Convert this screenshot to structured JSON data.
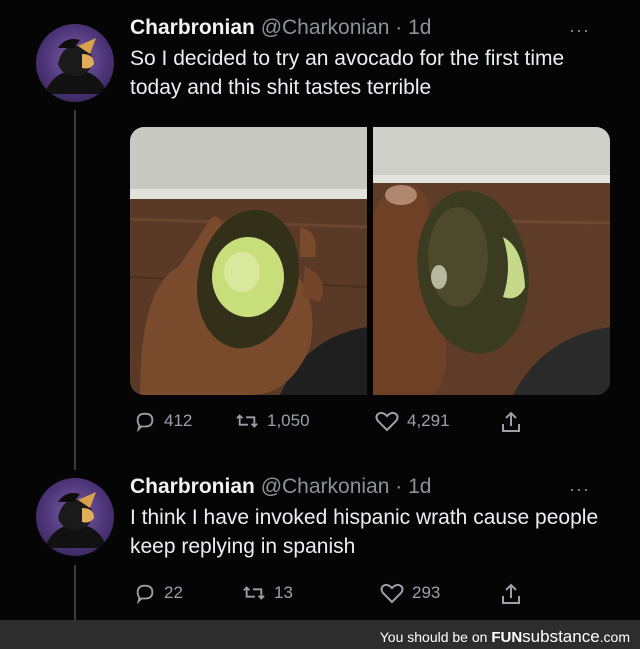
{
  "tweets": [
    {
      "name": "Charbronian",
      "handle": "@Charkonian",
      "time": "· 1d",
      "more": "···",
      "text": "So I decided to try an avocado for the first time today and this shit tastes terrible",
      "replies": "412",
      "retweets": "1,050",
      "likes": "4,291"
    },
    {
      "name": "Charbronian",
      "handle": "@Charkonian",
      "time": "· 1d",
      "more": "···",
      "text": "I think I have invoked hispanic wrath cause people keep replying in spanish",
      "replies": "22",
      "retweets": "13",
      "likes": "293"
    }
  ],
  "footer": {
    "prefix": "You should be on",
    "brand_bold": "FUN",
    "brand_rest": "substance",
    "brand_tld": ".com"
  },
  "icons": [
    "reply-icon",
    "retweet-icon",
    "like-icon",
    "share-icon",
    "more-icon"
  ],
  "colors": {
    "background": "#050505",
    "text": "#e7e9ea",
    "muted": "#8b9299",
    "footer": "#2d2d2d"
  }
}
